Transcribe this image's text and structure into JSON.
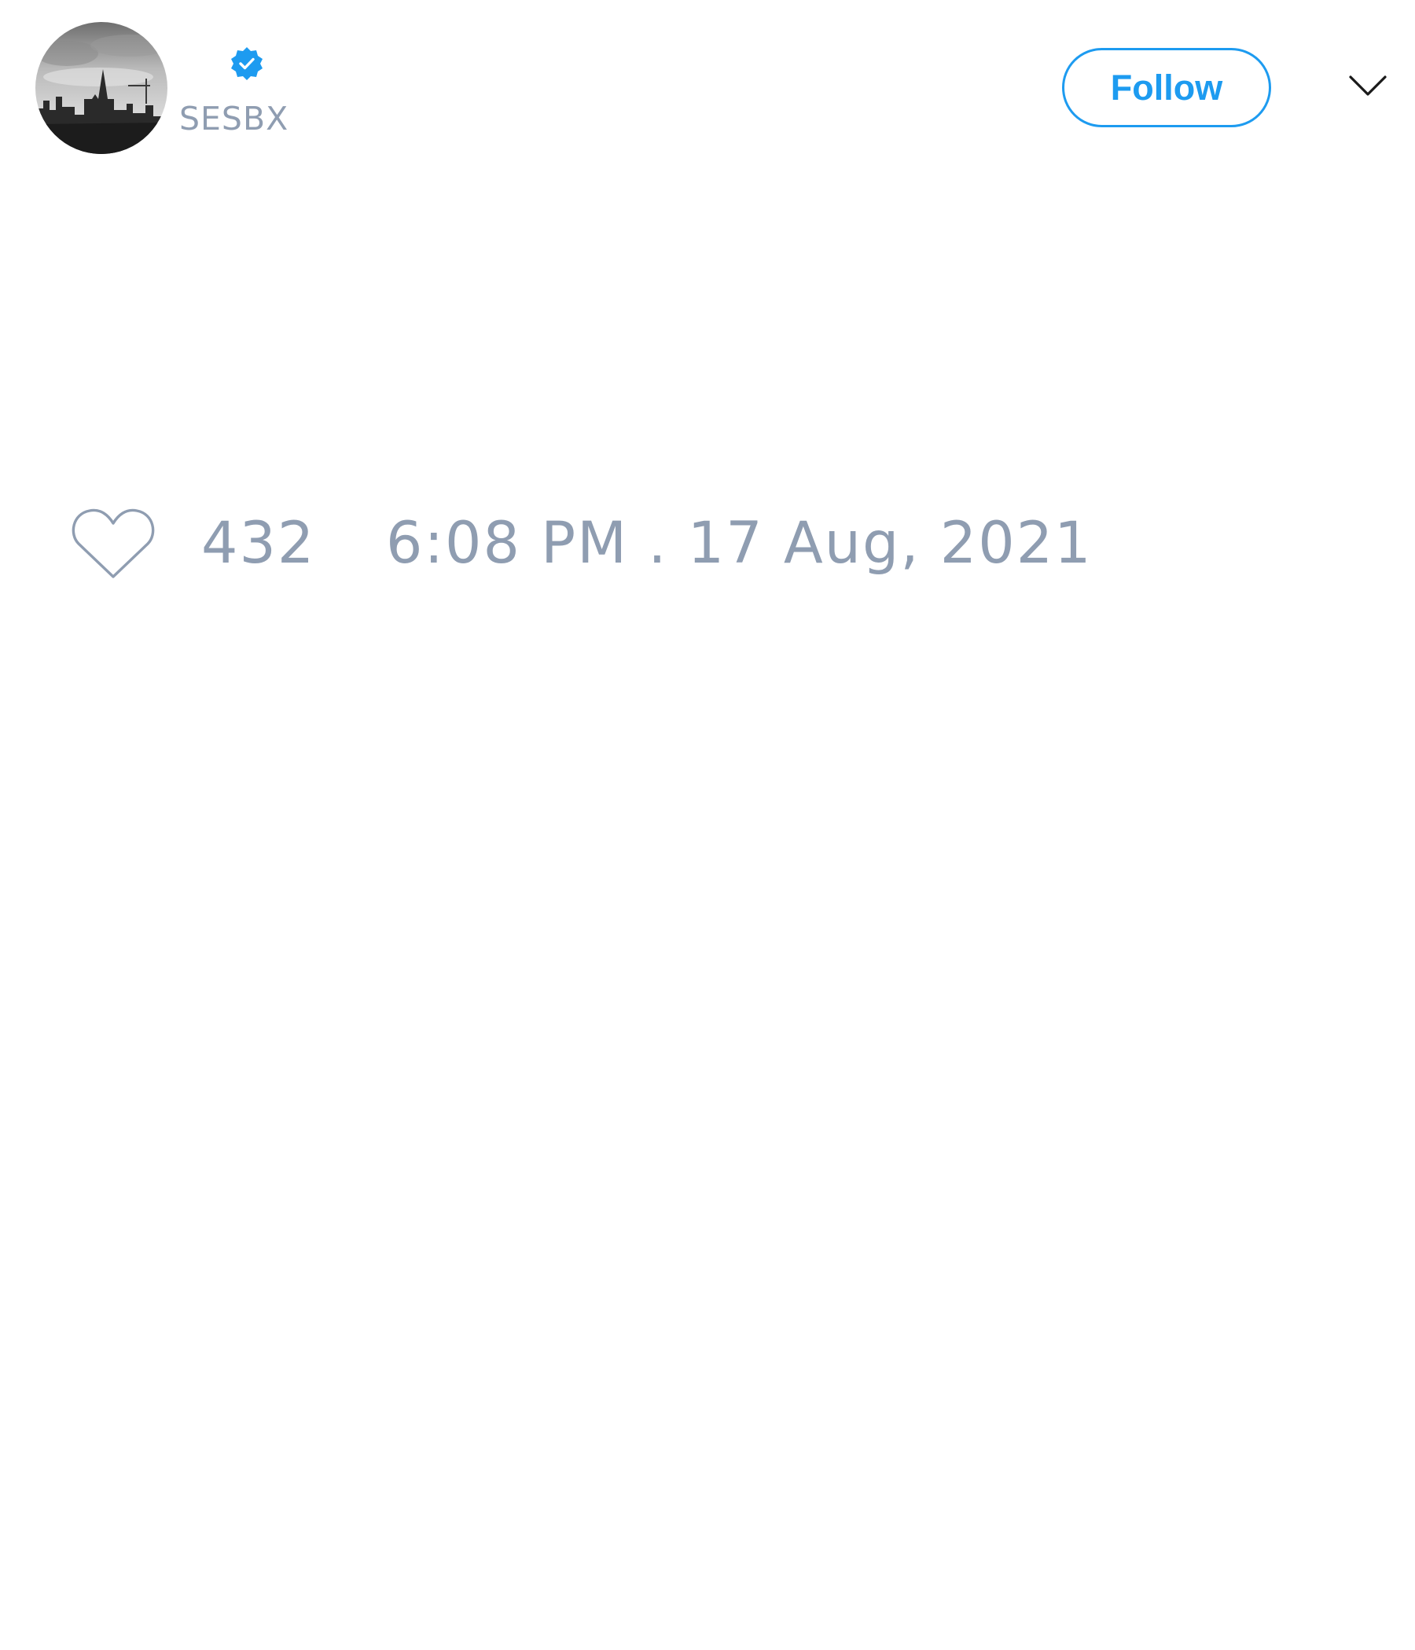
{
  "tweet": {
    "author": {
      "handle": "SESBX",
      "verified": true,
      "avatar_icon": "city-skyline-photo"
    },
    "actions": {
      "follow_label": "Follow",
      "more_icon": "chevron-down-icon"
    },
    "stats": {
      "like_icon": "heart-outline-icon",
      "like_count": "432",
      "timestamp": "6:08 PM . 17 Aug, 2021"
    }
  },
  "colors": {
    "accent": "#1d9bf0",
    "muted_text": "#8f9db1",
    "background": "#ffffff"
  }
}
